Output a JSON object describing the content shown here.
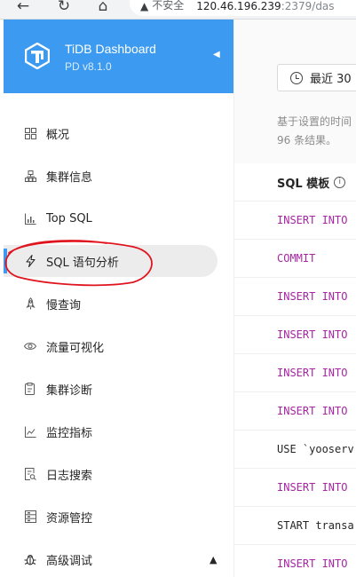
{
  "browser": {
    "security_label": "不安全",
    "url_host": "120.46.196.239",
    "url_rest": ":2379/das"
  },
  "brand": {
    "title": "TiDB Dashboard",
    "version": "PD v8.1.0"
  },
  "menu": [
    {
      "label": "概况",
      "icon": "dashboard-grid-icon"
    },
    {
      "label": "集群信息",
      "icon": "cluster-icon"
    },
    {
      "label": "Top SQL",
      "icon": "bar-chart-icon"
    },
    {
      "label": "SQL 语句分析",
      "icon": "lightning-icon",
      "active": true
    },
    {
      "label": "慢查询",
      "icon": "rocket-icon"
    },
    {
      "label": "流量可视化",
      "icon": "eye-icon"
    },
    {
      "label": "集群诊断",
      "icon": "diagnosis-icon"
    },
    {
      "label": "监控指标",
      "icon": "line-chart-icon"
    },
    {
      "label": "日志搜索",
      "icon": "file-search-icon"
    },
    {
      "label": "资源管控",
      "icon": "resource-icon"
    },
    {
      "label": "高级调试",
      "icon": "bug-icon"
    }
  ],
  "main": {
    "time_range_label": "最近 30",
    "description_line1": "基于设置的时间",
    "description_line2": "96 条结果。",
    "column_header": "SQL 模板",
    "rows": [
      {
        "kind": "kw",
        "text": "INSERT INTO"
      },
      {
        "kind": "kw",
        "text": "COMMIT"
      },
      {
        "kind": "kw",
        "text": "INSERT INTO"
      },
      {
        "kind": "kw",
        "text": "INSERT INTO"
      },
      {
        "kind": "kw",
        "text": "INSERT INTO"
      },
      {
        "kind": "kw",
        "text": "INSERT INTO"
      },
      {
        "kind": "plain",
        "text": "USE `yooserv"
      },
      {
        "kind": "kw",
        "text": "INSERT INTO"
      },
      {
        "kind": "plain",
        "text": "START transa"
      },
      {
        "kind": "kw",
        "text": "INSERT INTO"
      }
    ]
  },
  "colors": {
    "brand": "#3c9bf0",
    "sql_keyword": "#a626a4",
    "annotation_stroke": "#e0141e"
  }
}
